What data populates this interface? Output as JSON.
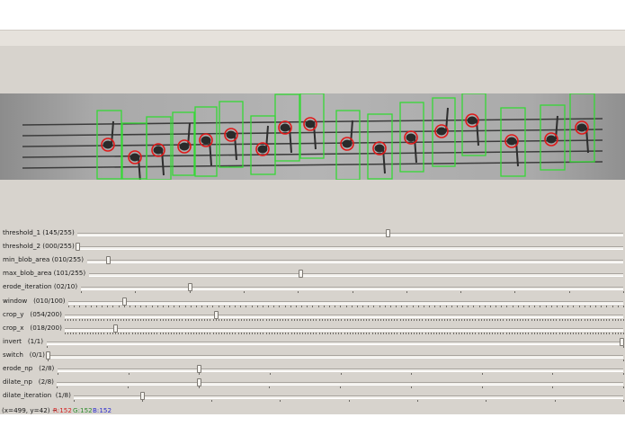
{
  "window": {
    "image_alt": "processed sheet music strip with detected note blobs"
  },
  "colors": {
    "panel_bg": "#d7d3cd",
    "detection_box": "#36d836",
    "blob_circle": "#e01818",
    "status_r": "#d42020",
    "status_g": "#2a8a2a",
    "status_b": "#2a2ad0"
  },
  "trackbars": [
    {
      "label": "threshold_1 (145/255)",
      "value": 145,
      "max": 255,
      "ticks": 0
    },
    {
      "label": "threshold_2 (000/255)",
      "value": 0,
      "max": 255,
      "ticks": 0
    },
    {
      "label": "min_blob_area (010/255)",
      "value": 10,
      "max": 255,
      "ticks": 0
    },
    {
      "label": "max_blob_area (101/255)",
      "value": 101,
      "max": 255,
      "ticks": 0
    },
    {
      "label": "erode_iteration (02/10)",
      "value": 2,
      "max": 10,
      "ticks": 10
    },
    {
      "label": "window   (010/100)",
      "value": 10,
      "max": 100,
      "ticks": 100
    },
    {
      "label": "crop_y   (054/200)",
      "value": 54,
      "max": 200,
      "ticks": 200
    },
    {
      "label": "crop_x   (018/200)",
      "value": 18,
      "max": 200,
      "ticks": 200
    },
    {
      "label": "invert   (1/1)",
      "value": 1,
      "max": 1,
      "ticks": 1
    },
    {
      "label": "switch   (0/1)",
      "value": 0,
      "max": 1,
      "ticks": 1
    },
    {
      "label": "erode_np   (2/8)",
      "value": 2,
      "max": 8,
      "ticks": 8
    },
    {
      "label": "dilate_np   (2/8)",
      "value": 2,
      "max": 8,
      "ticks": 8
    },
    {
      "label": "dilate_iteration  (1/8)",
      "value": 1,
      "max": 8,
      "ticks": 8
    }
  ],
  "status": {
    "coords": "(x=499, y=42) ~",
    "r": "R:152",
    "g": "G:152",
    "b": "B:152"
  }
}
